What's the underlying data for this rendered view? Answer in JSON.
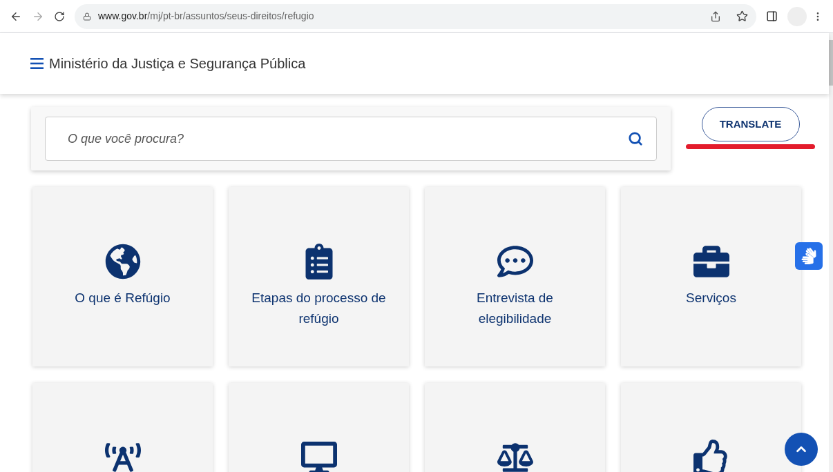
{
  "browser": {
    "url_host": "www.gov.br",
    "url_path": "/mj/pt-br/assuntos/seus-direitos/refugio"
  },
  "header": {
    "title": "Ministério da Justiça e Segurança Pública"
  },
  "search": {
    "placeholder": "O que você procura?"
  },
  "translate_button": {
    "label": "TRANSLATE"
  },
  "cards": [
    {
      "kind": "globe",
      "label": "O que é Refúgio"
    },
    {
      "kind": "clipboard",
      "label": "Etapas do processo de refúgio"
    },
    {
      "kind": "chat",
      "label": "Entrevista de elegibilidade"
    },
    {
      "kind": "briefcase",
      "label": "Serviços"
    },
    {
      "kind": "antenna"
    },
    {
      "kind": "monitor"
    },
    {
      "kind": "scales"
    },
    {
      "kind": "thumb"
    }
  ]
}
